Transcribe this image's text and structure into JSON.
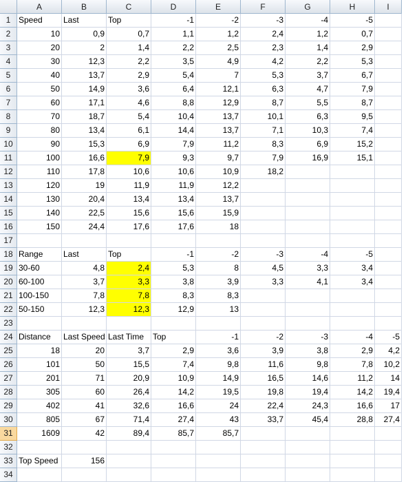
{
  "columns": [
    "A",
    "B",
    "C",
    "D",
    "E",
    "F",
    "G",
    "H",
    "I"
  ],
  "highlight_color": "#ffff00",
  "active_row": 31,
  "rows": [
    {
      "n": "1",
      "cells": [
        {
          "v": "Speed",
          "t": "s"
        },
        {
          "v": "Last",
          "t": "s"
        },
        {
          "v": "Top",
          "t": "s"
        },
        {
          "v": "-1"
        },
        {
          "v": "-2"
        },
        {
          "v": "-3"
        },
        {
          "v": "-4"
        },
        {
          "v": "-5"
        },
        {
          "v": ""
        }
      ]
    },
    {
      "n": "2",
      "cells": [
        {
          "v": "10"
        },
        {
          "v": "0,9"
        },
        {
          "v": "0,7"
        },
        {
          "v": "1,1"
        },
        {
          "v": "1,2"
        },
        {
          "v": "2,4"
        },
        {
          "v": "1,2"
        },
        {
          "v": "0,7"
        },
        {
          "v": ""
        }
      ]
    },
    {
      "n": "3",
      "cells": [
        {
          "v": "20"
        },
        {
          "v": "2"
        },
        {
          "v": "1,4"
        },
        {
          "v": "2,2"
        },
        {
          "v": "2,5"
        },
        {
          "v": "2,3"
        },
        {
          "v": "1,4"
        },
        {
          "v": "2,9"
        },
        {
          "v": ""
        }
      ]
    },
    {
      "n": "4",
      "cells": [
        {
          "v": "30"
        },
        {
          "v": "12,3"
        },
        {
          "v": "2,2"
        },
        {
          "v": "3,5"
        },
        {
          "v": "4,9"
        },
        {
          "v": "4,2"
        },
        {
          "v": "2,2"
        },
        {
          "v": "5,3"
        },
        {
          "v": ""
        }
      ]
    },
    {
      "n": "5",
      "cells": [
        {
          "v": "40"
        },
        {
          "v": "13,7"
        },
        {
          "v": "2,9"
        },
        {
          "v": "5,4"
        },
        {
          "v": "7"
        },
        {
          "v": "5,3"
        },
        {
          "v": "3,7"
        },
        {
          "v": "6,7"
        },
        {
          "v": ""
        }
      ]
    },
    {
      "n": "6",
      "cells": [
        {
          "v": "50"
        },
        {
          "v": "14,9"
        },
        {
          "v": "3,6"
        },
        {
          "v": "6,4"
        },
        {
          "v": "12,1"
        },
        {
          "v": "6,3"
        },
        {
          "v": "4,7"
        },
        {
          "v": "7,9"
        },
        {
          "v": ""
        }
      ]
    },
    {
      "n": "7",
      "cells": [
        {
          "v": "60"
        },
        {
          "v": "17,1"
        },
        {
          "v": "4,6"
        },
        {
          "v": "8,8"
        },
        {
          "v": "12,9"
        },
        {
          "v": "8,7"
        },
        {
          "v": "5,5"
        },
        {
          "v": "8,7"
        },
        {
          "v": ""
        }
      ]
    },
    {
      "n": "8",
      "cells": [
        {
          "v": "70"
        },
        {
          "v": "18,7"
        },
        {
          "v": "5,4"
        },
        {
          "v": "10,4"
        },
        {
          "v": "13,7"
        },
        {
          "v": "10,1"
        },
        {
          "v": "6,3"
        },
        {
          "v": "9,5"
        },
        {
          "v": ""
        }
      ]
    },
    {
      "n": "9",
      "cells": [
        {
          "v": "80"
        },
        {
          "v": "13,4"
        },
        {
          "v": "6,1"
        },
        {
          "v": "14,4"
        },
        {
          "v": "13,7"
        },
        {
          "v": "7,1"
        },
        {
          "v": "10,3"
        },
        {
          "v": "7,4"
        },
        {
          "v": ""
        }
      ]
    },
    {
      "n": "10",
      "cells": [
        {
          "v": "90"
        },
        {
          "v": "15,3"
        },
        {
          "v": "6,9"
        },
        {
          "v": "7,9"
        },
        {
          "v": "11,2"
        },
        {
          "v": "8,3"
        },
        {
          "v": "6,9"
        },
        {
          "v": "15,2"
        },
        {
          "v": ""
        }
      ]
    },
    {
      "n": "11",
      "cells": [
        {
          "v": "100"
        },
        {
          "v": "16,6"
        },
        {
          "v": "7,9",
          "hl": true
        },
        {
          "v": "9,3"
        },
        {
          "v": "9,7"
        },
        {
          "v": "7,9"
        },
        {
          "v": "16,9"
        },
        {
          "v": "15,1"
        },
        {
          "v": ""
        }
      ]
    },
    {
      "n": "12",
      "cells": [
        {
          "v": "110"
        },
        {
          "v": "17,8"
        },
        {
          "v": "10,6"
        },
        {
          "v": "10,6"
        },
        {
          "v": "10,9"
        },
        {
          "v": "18,2"
        },
        {
          "v": ""
        },
        {
          "v": ""
        },
        {
          "v": ""
        }
      ]
    },
    {
      "n": "13",
      "cells": [
        {
          "v": "120"
        },
        {
          "v": "19"
        },
        {
          "v": "11,9"
        },
        {
          "v": "11,9"
        },
        {
          "v": "12,2"
        },
        {
          "v": ""
        },
        {
          "v": ""
        },
        {
          "v": ""
        },
        {
          "v": ""
        }
      ]
    },
    {
      "n": "14",
      "cells": [
        {
          "v": "130"
        },
        {
          "v": "20,4"
        },
        {
          "v": "13,4"
        },
        {
          "v": "13,4"
        },
        {
          "v": "13,7"
        },
        {
          "v": ""
        },
        {
          "v": ""
        },
        {
          "v": ""
        },
        {
          "v": ""
        }
      ]
    },
    {
      "n": "15",
      "cells": [
        {
          "v": "140"
        },
        {
          "v": "22,5"
        },
        {
          "v": "15,6"
        },
        {
          "v": "15,6"
        },
        {
          "v": "15,9"
        },
        {
          "v": ""
        },
        {
          "v": ""
        },
        {
          "v": ""
        },
        {
          "v": ""
        }
      ]
    },
    {
      "n": "16",
      "cells": [
        {
          "v": "150"
        },
        {
          "v": "24,4"
        },
        {
          "v": "17,6"
        },
        {
          "v": "17,6"
        },
        {
          "v": "18"
        },
        {
          "v": ""
        },
        {
          "v": ""
        },
        {
          "v": ""
        },
        {
          "v": ""
        }
      ]
    },
    {
      "n": "17",
      "cells": [
        {
          "v": ""
        },
        {
          "v": ""
        },
        {
          "v": ""
        },
        {
          "v": ""
        },
        {
          "v": ""
        },
        {
          "v": ""
        },
        {
          "v": ""
        },
        {
          "v": ""
        },
        {
          "v": ""
        }
      ]
    },
    {
      "n": "18",
      "cells": [
        {
          "v": "Range",
          "t": "s"
        },
        {
          "v": "Last",
          "t": "s"
        },
        {
          "v": "Top",
          "t": "s"
        },
        {
          "v": "-1"
        },
        {
          "v": "-2"
        },
        {
          "v": "-3"
        },
        {
          "v": "-4"
        },
        {
          "v": "-5"
        },
        {
          "v": ""
        }
      ]
    },
    {
      "n": "19",
      "cells": [
        {
          "v": "30-60",
          "t": "s"
        },
        {
          "v": "4,8"
        },
        {
          "v": "2,4",
          "hl": true
        },
        {
          "v": "5,3"
        },
        {
          "v": "8"
        },
        {
          "v": "4,5"
        },
        {
          "v": "3,3"
        },
        {
          "v": "3,4"
        },
        {
          "v": ""
        }
      ]
    },
    {
      "n": "20",
      "cells": [
        {
          "v": "60-100",
          "t": "s"
        },
        {
          "v": "3,7"
        },
        {
          "v": "3,3",
          "hl": true
        },
        {
          "v": "3,8"
        },
        {
          "v": "3,9"
        },
        {
          "v": "3,3"
        },
        {
          "v": "4,1"
        },
        {
          "v": "3,4"
        },
        {
          "v": ""
        }
      ]
    },
    {
      "n": "21",
      "cells": [
        {
          "v": "100-150",
          "t": "s"
        },
        {
          "v": "7,8"
        },
        {
          "v": "7,8",
          "hl": true
        },
        {
          "v": "8,3"
        },
        {
          "v": "8,3"
        },
        {
          "v": ""
        },
        {
          "v": ""
        },
        {
          "v": ""
        },
        {
          "v": ""
        }
      ]
    },
    {
      "n": "22",
      "cells": [
        {
          "v": "50-150",
          "t": "s"
        },
        {
          "v": "12,3"
        },
        {
          "v": "12,3",
          "hl": true
        },
        {
          "v": "12,9"
        },
        {
          "v": "13"
        },
        {
          "v": ""
        },
        {
          "v": ""
        },
        {
          "v": ""
        },
        {
          "v": ""
        }
      ]
    },
    {
      "n": "23",
      "cells": [
        {
          "v": ""
        },
        {
          "v": ""
        },
        {
          "v": ""
        },
        {
          "v": ""
        },
        {
          "v": ""
        },
        {
          "v": ""
        },
        {
          "v": ""
        },
        {
          "v": ""
        },
        {
          "v": ""
        }
      ]
    },
    {
      "n": "24",
      "cells": [
        {
          "v": "Distance",
          "t": "s"
        },
        {
          "v": "Last Speed",
          "t": "s"
        },
        {
          "v": "Last Time",
          "t": "s"
        },
        {
          "v": "Top",
          "t": "s"
        },
        {
          "v": "-1"
        },
        {
          "v": "-2"
        },
        {
          "v": "-3"
        },
        {
          "v": "-4"
        },
        {
          "v": "-5"
        }
      ]
    },
    {
      "n": "25",
      "cells": [
        {
          "v": "18"
        },
        {
          "v": "20"
        },
        {
          "v": "3,7"
        },
        {
          "v": "2,9"
        },
        {
          "v": "3,6"
        },
        {
          "v": "3,9"
        },
        {
          "v": "3,8"
        },
        {
          "v": "2,9"
        },
        {
          "v": "4,2"
        }
      ]
    },
    {
      "n": "26",
      "cells": [
        {
          "v": "101"
        },
        {
          "v": "50"
        },
        {
          "v": "15,5"
        },
        {
          "v": "7,4"
        },
        {
          "v": "9,8"
        },
        {
          "v": "11,6"
        },
        {
          "v": "9,8"
        },
        {
          "v": "7,8"
        },
        {
          "v": "10,2"
        }
      ]
    },
    {
      "n": "27",
      "cells": [
        {
          "v": "201"
        },
        {
          "v": "71"
        },
        {
          "v": "20,9"
        },
        {
          "v": "10,9"
        },
        {
          "v": "14,9"
        },
        {
          "v": "16,5"
        },
        {
          "v": "14,6"
        },
        {
          "v": "11,2"
        },
        {
          "v": "14"
        }
      ]
    },
    {
      "n": "28",
      "cells": [
        {
          "v": "305"
        },
        {
          "v": "60"
        },
        {
          "v": "26,4"
        },
        {
          "v": "14,2"
        },
        {
          "v": "19,5"
        },
        {
          "v": "19,8"
        },
        {
          "v": "19,4"
        },
        {
          "v": "14,2"
        },
        {
          "v": "19,4"
        }
      ]
    },
    {
      "n": "29",
      "cells": [
        {
          "v": "402"
        },
        {
          "v": "41"
        },
        {
          "v": "32,6"
        },
        {
          "v": "16,6"
        },
        {
          "v": "24"
        },
        {
          "v": "22,4"
        },
        {
          "v": "24,3"
        },
        {
          "v": "16,6"
        },
        {
          "v": "17"
        }
      ]
    },
    {
      "n": "30",
      "cells": [
        {
          "v": "805"
        },
        {
          "v": "67"
        },
        {
          "v": "71,4"
        },
        {
          "v": "27,4"
        },
        {
          "v": "43"
        },
        {
          "v": "33,7"
        },
        {
          "v": "45,4"
        },
        {
          "v": "28,8"
        },
        {
          "v": "27,4"
        }
      ]
    },
    {
      "n": "31",
      "cells": [
        {
          "v": "1609"
        },
        {
          "v": "42"
        },
        {
          "v": "89,4"
        },
        {
          "v": "85,7"
        },
        {
          "v": "85,7"
        },
        {
          "v": ""
        },
        {
          "v": ""
        },
        {
          "v": ""
        },
        {
          "v": ""
        }
      ]
    },
    {
      "n": "32",
      "cells": [
        {
          "v": ""
        },
        {
          "v": ""
        },
        {
          "v": ""
        },
        {
          "v": ""
        },
        {
          "v": ""
        },
        {
          "v": ""
        },
        {
          "v": ""
        },
        {
          "v": ""
        },
        {
          "v": ""
        }
      ]
    },
    {
      "n": "33",
      "cells": [
        {
          "v": "Top Speed",
          "t": "s"
        },
        {
          "v": "156"
        },
        {
          "v": ""
        },
        {
          "v": ""
        },
        {
          "v": ""
        },
        {
          "v": ""
        },
        {
          "v": ""
        },
        {
          "v": ""
        },
        {
          "v": ""
        }
      ]
    },
    {
      "n": "34",
      "cells": [
        {
          "v": ""
        },
        {
          "v": ""
        },
        {
          "v": ""
        },
        {
          "v": ""
        },
        {
          "v": ""
        },
        {
          "v": ""
        },
        {
          "v": ""
        },
        {
          "v": ""
        },
        {
          "v": ""
        }
      ]
    }
  ]
}
